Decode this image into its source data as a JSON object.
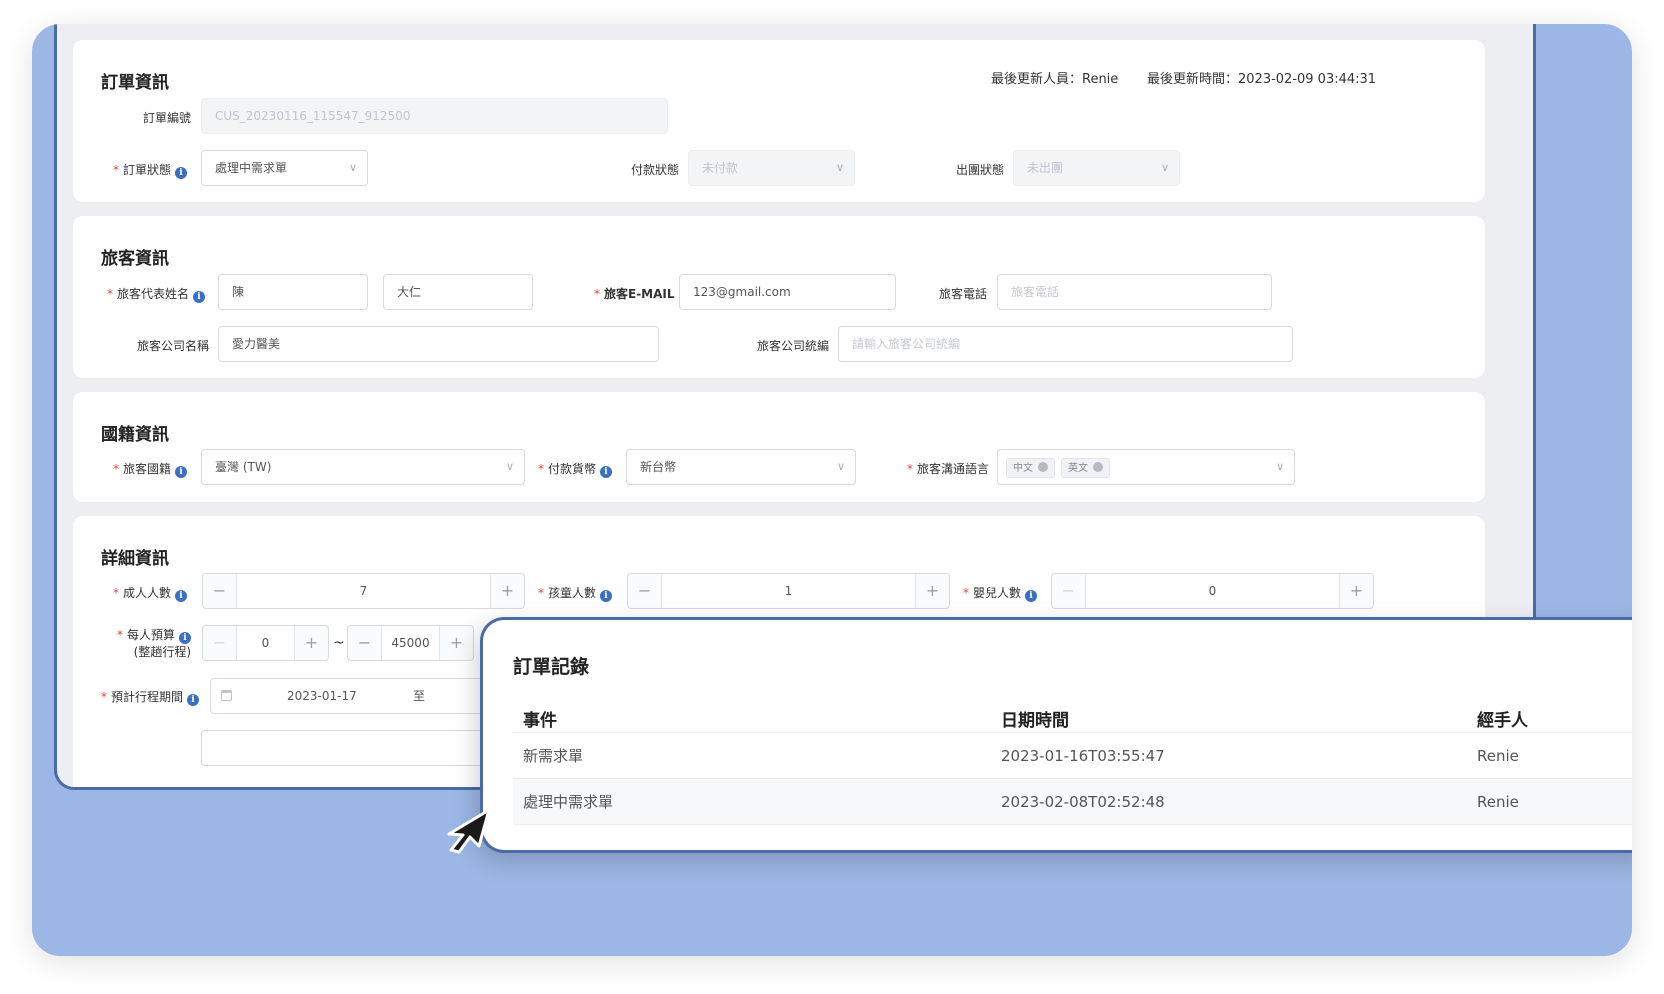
{
  "order": {
    "title": "訂單資訊",
    "last_editor": "最後更新人員：Renie",
    "last_updated": "最後更新時間：2023-02-09 03:44:31",
    "number_label": "訂單編號",
    "number_value": "CUS_20230116_115547_912500",
    "status_label": "訂單狀態",
    "status_value": "處理中需求單",
    "payment_label": "付款狀態",
    "payment_value": "未付款",
    "departure_label": "出團狀態",
    "departure_value": "未出團"
  },
  "traveler": {
    "title": "旅客資訊",
    "name_label": "旅客代表姓名",
    "last_name": "陳",
    "first_name": "大仁",
    "email_label": "旅客E-MAIL",
    "email_value": "123@gmail.com",
    "phone_label": "旅客電話",
    "phone_placeholder": "旅客電話",
    "company_label": "旅客公司名稱",
    "company_value": "愛力醫美",
    "tax_label": "旅客公司統編",
    "tax_placeholder": "請輸入旅客公司統編"
  },
  "nationality": {
    "title": "國籍資訊",
    "country_label": "旅客國籍",
    "country_value": "臺灣 (TW)",
    "currency_label": "付款貨幣",
    "currency_value": "新台幣",
    "language_label": "旅客溝通語言",
    "languages": [
      "中文",
      "英文"
    ]
  },
  "details": {
    "title": "詳細資訊",
    "adults_label": "成人人數",
    "adults_value": "7",
    "children_label": "孩童人數",
    "children_value": "1",
    "infants_label": "嬰兒人數",
    "infants_value": "0",
    "budget_label": "每人預算",
    "budget_sub": "(整趟行程)",
    "budget_min": "0",
    "budget_sep": "~",
    "budget_max": "45000",
    "period_label": "預計行程期間",
    "period_start": "2023-01-17",
    "period_to": "至"
  },
  "records": {
    "title": "訂單記錄",
    "headers": [
      "事件",
      "日期時間",
      "經手人"
    ],
    "rows": [
      {
        "event": "新需求單",
        "datetime": "2023-01-16T03:55:47",
        "handler": "Renie"
      },
      {
        "event": "處理中需求單",
        "datetime": "2023-02-08T02:52:48",
        "handler": "Renie"
      }
    ]
  },
  "icons": {
    "info": "info-icon",
    "dropdown": "chevron-down-icon",
    "calendar": "calendar-icon",
    "cursor": "mouse-pointer-icon"
  },
  "colors": {
    "background": "#9cb6e5",
    "frame": "#4a6ba8",
    "required": "#e4473c",
    "info": "#3b6fc4"
  }
}
